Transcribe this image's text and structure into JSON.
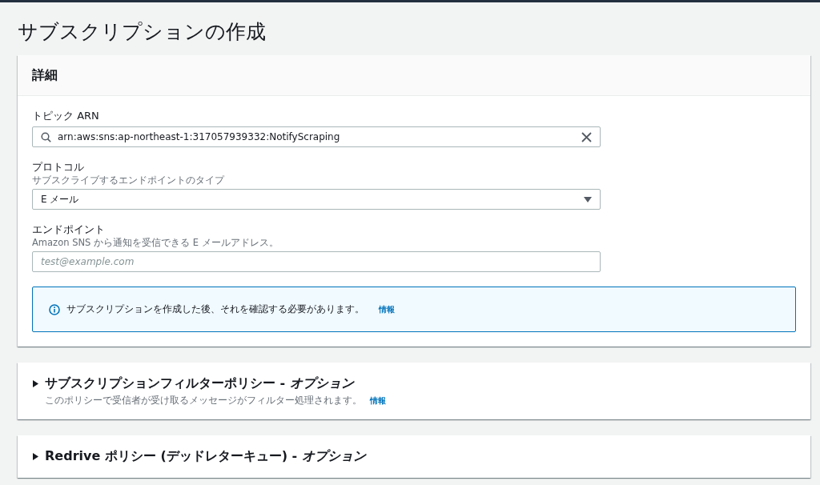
{
  "page_title": "サブスクリプションの作成",
  "details": {
    "title": "詳細",
    "topic_arn": {
      "label": "トピック ARN",
      "value": "arn:aws:sns:ap-northeast-1:317057939332:NotifyScraping"
    },
    "protocol": {
      "label": "プロトコル",
      "description": "サブスクライブするエンドポイントのタイプ",
      "value": "E メール"
    },
    "endpoint": {
      "label": "エンドポイント",
      "description": "Amazon SNS から通知を受信できる E メールアドレス。",
      "placeholder": "test@example.com"
    },
    "info_alert": {
      "text": "サブスクリプションを作成した後、それを確認する必要があります。",
      "link": "情報"
    }
  },
  "sections": [
    {
      "title": "サブスクリプションフィルターポリシー - *オプション*",
      "description": "このポリシーで受信者が受け取るメッセージがフィルター処理されます。",
      "link": "情報",
      "expanded": false
    },
    {
      "title": "Redrive ポリシー (デッドレターキュー) - *オプション*",
      "expanded": false
    }
  ]
}
